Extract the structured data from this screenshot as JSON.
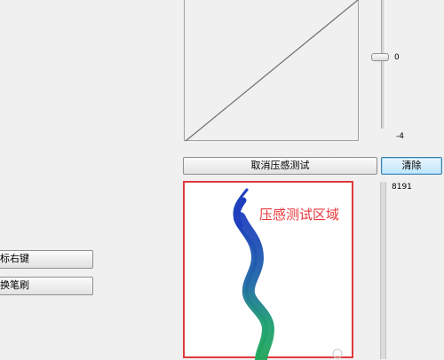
{
  "curve": {
    "slider_value": "0",
    "slider_min": "-4"
  },
  "buttons": {
    "cancel_test": "取消压感测试",
    "clear": "清除",
    "mouse_right": "鼠标右键",
    "switch_brush": "切换笔刷"
  },
  "pressure": {
    "area_title": "压感测试区域",
    "max_value": "8191"
  },
  "colors": {
    "test_area_border": "#e0393b",
    "stroke_start": "#1f3fbf",
    "stroke_end": "#21a65a"
  }
}
